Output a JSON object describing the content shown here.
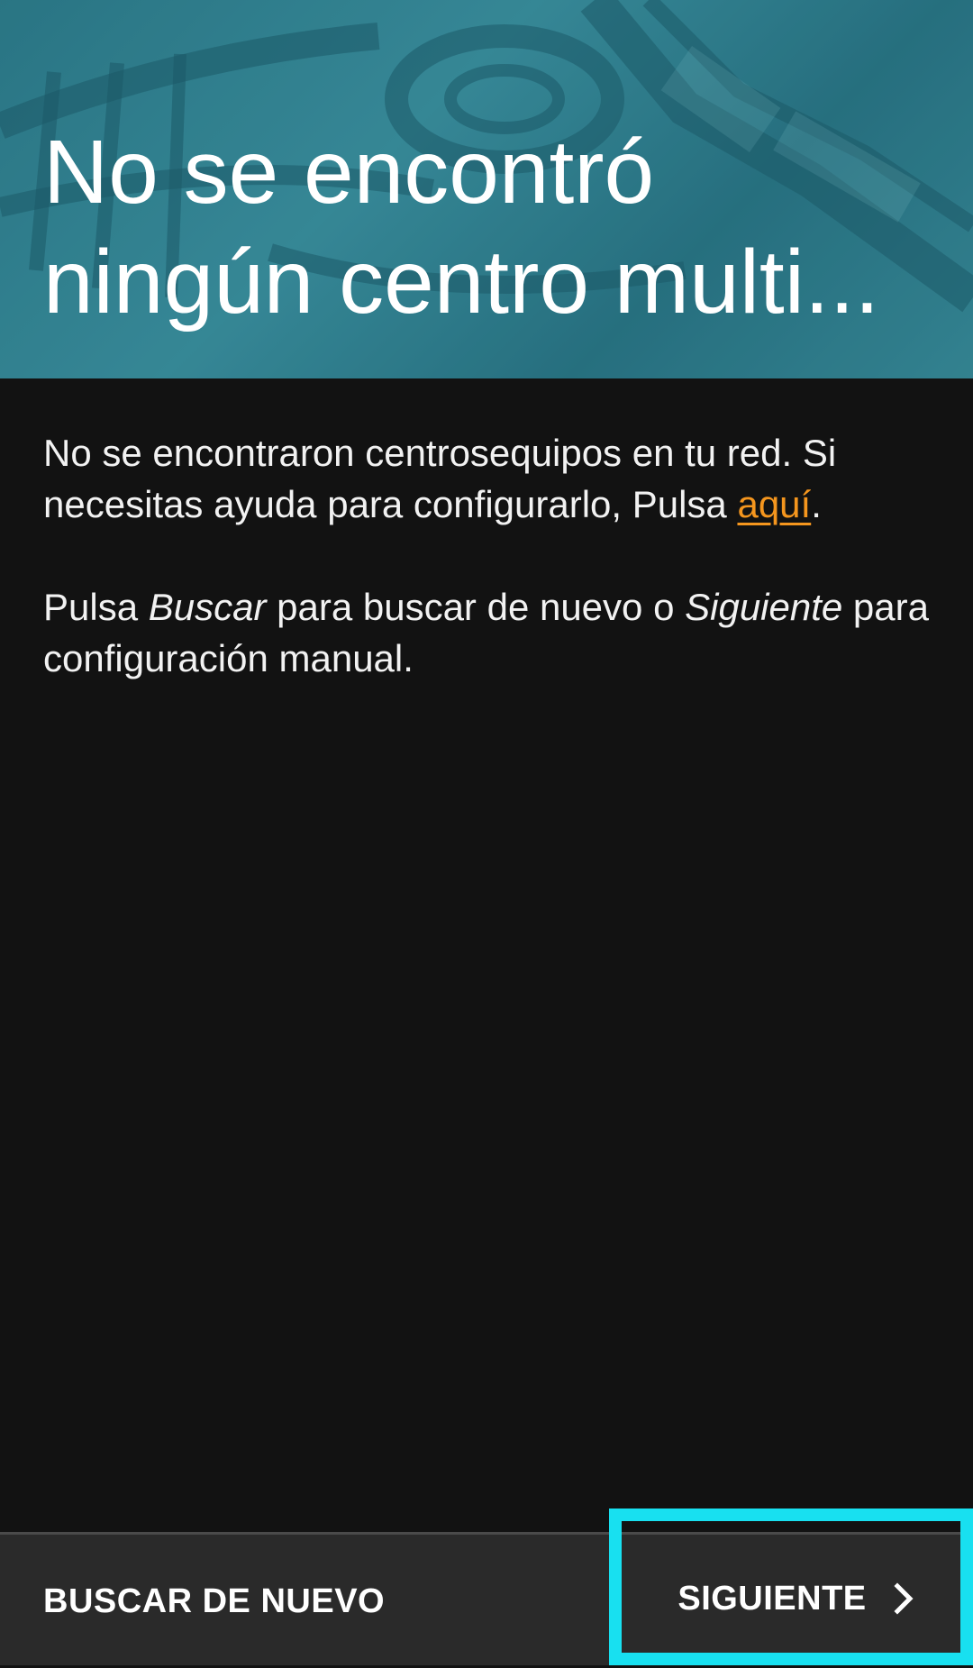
{
  "header": {
    "title_line1": "No se encontró",
    "title_line2": "ningún centro multi..."
  },
  "body": {
    "paragraph1_text": "No se encontraron centrosequipos en tu red. Si necesitas ayuda para configurarlo, Pulsa ",
    "link_text": "aquí",
    "paragraph1_end": ".",
    "p2_a": "Pulsa ",
    "p2_buscar": "Buscar",
    "p2_b": " para buscar de nuevo o ",
    "p2_siguiente": "Siguiente",
    "p2_c": " para configuración manual."
  },
  "footer": {
    "search_again_label": "BUSCAR DE NUEVO",
    "next_label": "SIGUIENTE"
  },
  "colors": {
    "header_teal": "#3d94a3",
    "link_orange": "#f5961e",
    "highlight_cyan": "#18e0f0",
    "background": "#121212",
    "footer_bg": "#2a2a2a"
  },
  "icons": {
    "next": "chevron-right-icon"
  }
}
